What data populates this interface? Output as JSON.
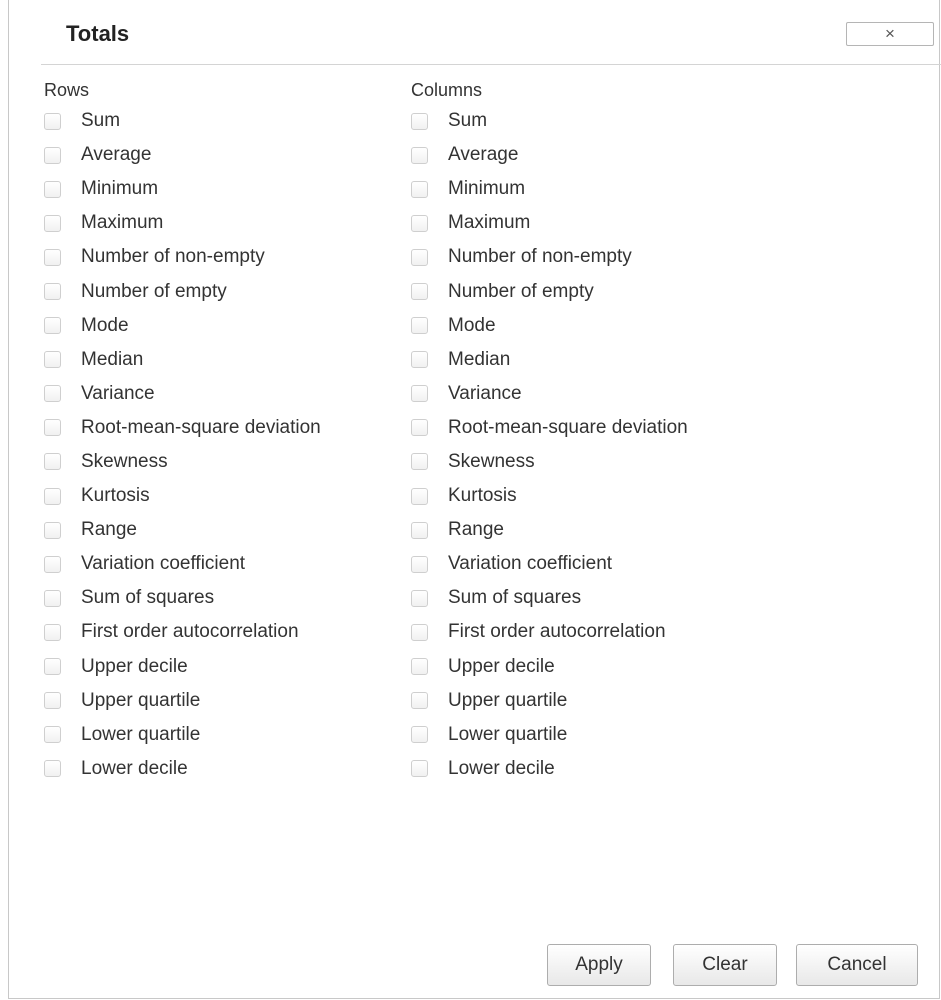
{
  "dialog": {
    "title": "Totals",
    "close_label": "×"
  },
  "rows": {
    "header": "Rows",
    "options": [
      {
        "label": "Sum",
        "checked": false
      },
      {
        "label": "Average",
        "checked": false
      },
      {
        "label": "Minimum",
        "checked": false
      },
      {
        "label": "Maximum",
        "checked": false
      },
      {
        "label": "Number of non-empty",
        "checked": false
      },
      {
        "label": "Number of empty",
        "checked": false
      },
      {
        "label": "Mode",
        "checked": false
      },
      {
        "label": "Median",
        "checked": false
      },
      {
        "label": "Variance",
        "checked": false
      },
      {
        "label": "Root-mean-square deviation",
        "checked": false
      },
      {
        "label": "Skewness",
        "checked": false
      },
      {
        "label": "Kurtosis",
        "checked": false
      },
      {
        "label": "Range",
        "checked": false
      },
      {
        "label": "Variation coefficient",
        "checked": false
      },
      {
        "label": "Sum of squares",
        "checked": false
      },
      {
        "label": "First order autocorrelation",
        "checked": false
      },
      {
        "label": "Upper decile",
        "checked": false
      },
      {
        "label": "Upper quartile",
        "checked": false
      },
      {
        "label": "Lower quartile",
        "checked": false
      },
      {
        "label": "Lower decile",
        "checked": false
      }
    ]
  },
  "columns": {
    "header": "Columns",
    "options": [
      {
        "label": "Sum",
        "checked": false
      },
      {
        "label": "Average",
        "checked": false
      },
      {
        "label": "Minimum",
        "checked": false
      },
      {
        "label": "Maximum",
        "checked": false
      },
      {
        "label": "Number of non-empty",
        "checked": false
      },
      {
        "label": "Number of empty",
        "checked": false
      },
      {
        "label": "Mode",
        "checked": false
      },
      {
        "label": "Median",
        "checked": false
      },
      {
        "label": "Variance",
        "checked": false
      },
      {
        "label": "Root-mean-square deviation",
        "checked": false
      },
      {
        "label": "Skewness",
        "checked": false
      },
      {
        "label": "Kurtosis",
        "checked": false
      },
      {
        "label": "Range",
        "checked": false
      },
      {
        "label": "Variation coefficient",
        "checked": false
      },
      {
        "label": "Sum of squares",
        "checked": false
      },
      {
        "label": "First order autocorrelation",
        "checked": false
      },
      {
        "label": "Upper decile",
        "checked": false
      },
      {
        "label": "Upper quartile",
        "checked": false
      },
      {
        "label": "Lower quartile",
        "checked": false
      },
      {
        "label": "Lower decile",
        "checked": false
      }
    ]
  },
  "footer": {
    "apply_label": "Apply",
    "clear_label": "Clear",
    "cancel_label": "Cancel"
  }
}
